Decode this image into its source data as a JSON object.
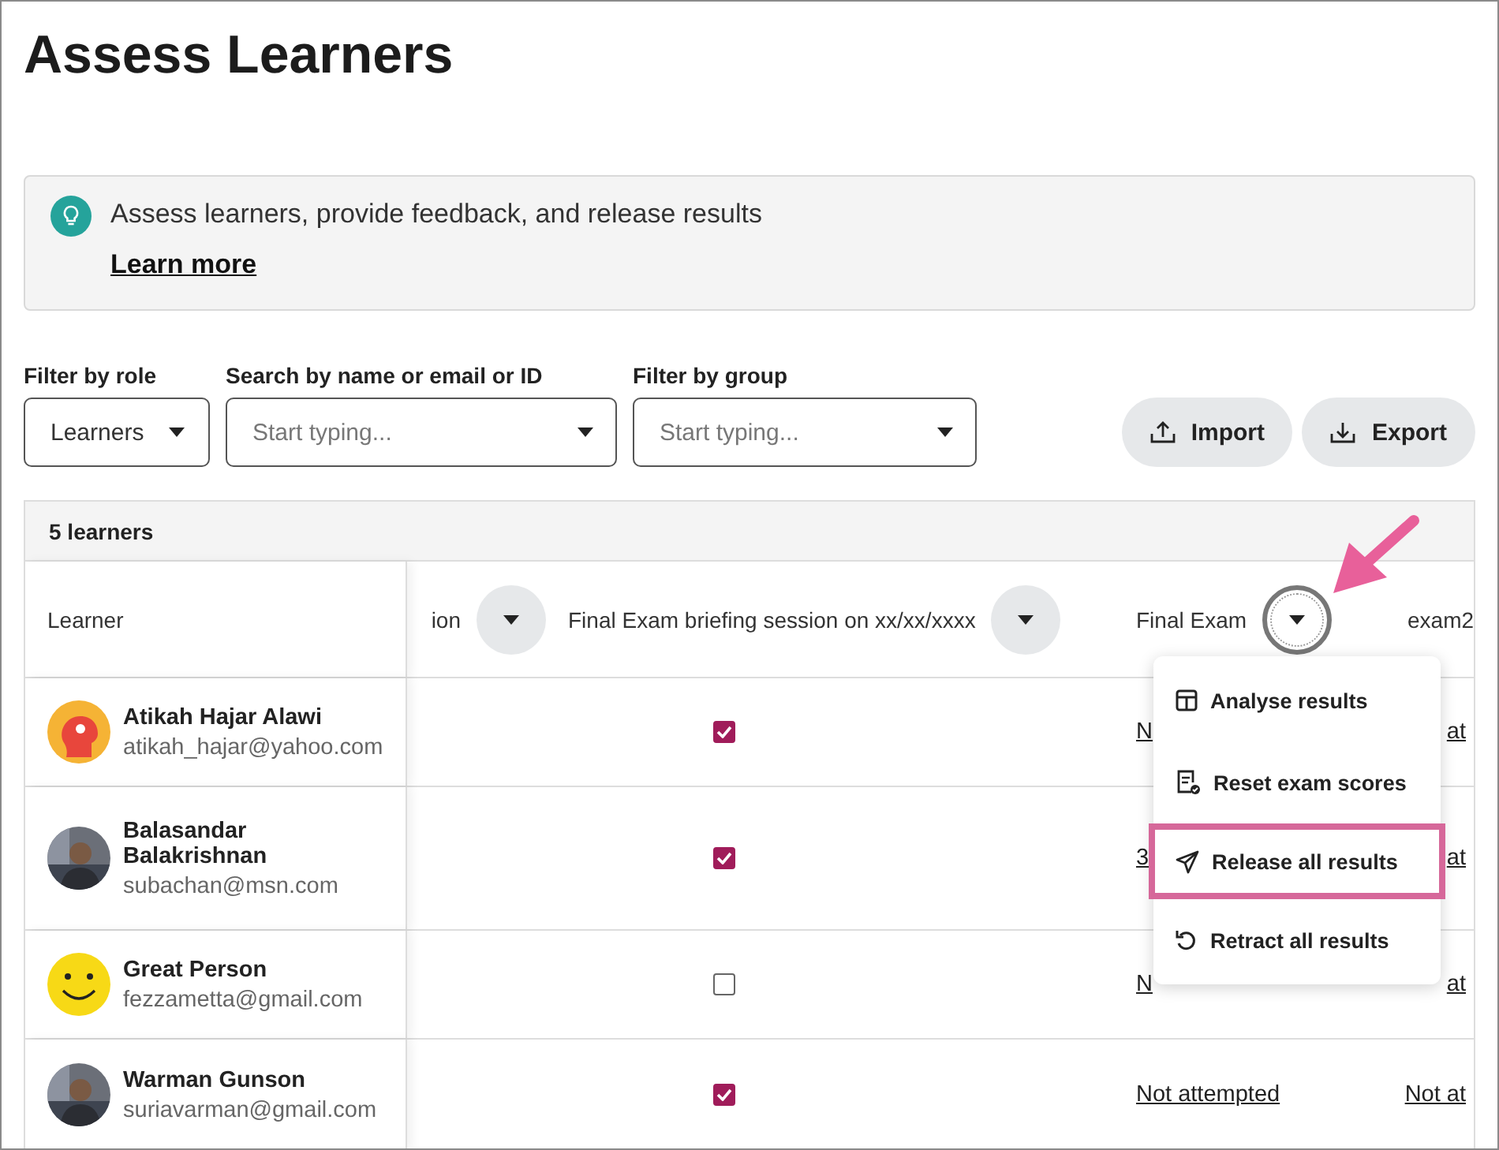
{
  "page": {
    "title": "Assess Learners"
  },
  "banner": {
    "text": "Assess learners, provide feedback, and release results",
    "link": "Learn more"
  },
  "filters": [
    {
      "label": "Filter by role",
      "value": "Learners"
    },
    {
      "label": "Search by name or email or ID",
      "placeholder": "Start typing..."
    },
    {
      "label": "Filter by group",
      "placeholder": "Start typing..."
    }
  ],
  "buttons": [
    {
      "label": "Import",
      "kind": "import"
    },
    {
      "label": "Export",
      "kind": "export"
    }
  ],
  "table": {
    "count": "5 learners",
    "columns": [
      {
        "label": "Learner"
      },
      {
        "label": "ion",
        "menu": {
          "focused": false
        }
      },
      {
        "label": "Final Exam briefing session on xx/xx/xxxx",
        "menu": {
          "focused": false
        }
      },
      {
        "label": "Final Exam",
        "menu": {
          "focused": true
        }
      },
      {
        "label": "exam2"
      }
    ],
    "rows": [
      {
        "name": "Atikah Hajar Alawi",
        "email": "atikah_hajar@yahoo.com",
        "avatar": {
          "kind": "icon",
          "color": "#f5b335"
        },
        "briefing_checked": true,
        "final_exam": "N",
        "exam2": "at"
      },
      {
        "name": "Balasandar Balakrishnan",
        "email": "subachan@msn.com",
        "briefing_checked": true,
        "final_exam": "3",
        "exam2": "at"
      },
      {
        "name": "Great Person",
        "email": "fezzametta@gmail.com",
        "avatar": {
          "kind": "emoji",
          "color": "#f7d916"
        },
        "briefing_checked": false,
        "final_exam": "N",
        "exam2": "at"
      },
      {
        "name": "Warman Gunson",
        "email": "suriavarman@gmail.com",
        "briefing_checked": true,
        "final_exam": "Not attempted",
        "exam2": "Not at"
      }
    ]
  },
  "menu": {
    "items": [
      {
        "label": "Analyse results",
        "kind": "analyse",
        "highlighted": false
      },
      {
        "label": "Reset exam scores",
        "kind": "reset",
        "highlighted": false
      },
      {
        "label": "Release all results",
        "kind": "release",
        "highlighted": true
      },
      {
        "label": "Retract all results",
        "kind": "retract",
        "highlighted": false
      }
    ]
  }
}
